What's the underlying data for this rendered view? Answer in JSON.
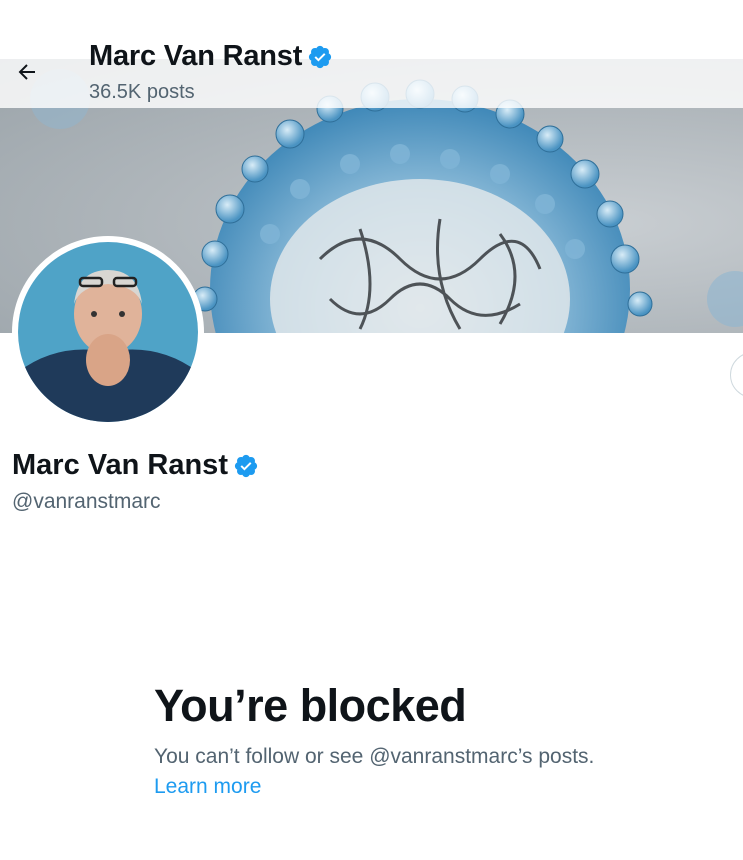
{
  "header": {
    "name": "Marc Van Ranst",
    "post_count": "36.5K posts",
    "back_icon": "arrow-left-icon",
    "verified_icon": "verified-badge-icon"
  },
  "profile": {
    "name": "Marc Van Ranst",
    "handle": "@vanranstmarc",
    "verified_icon": "verified-badge-icon"
  },
  "blocked": {
    "title": "You’re blocked",
    "message": "You can’t follow or see @vanranstmarc’s posts.",
    "link_label": "Learn more"
  },
  "colors": {
    "verified": "#1d9bf0",
    "link": "#1d9bf0",
    "secondary_text": "#536471",
    "primary_text": "#0f1419"
  }
}
